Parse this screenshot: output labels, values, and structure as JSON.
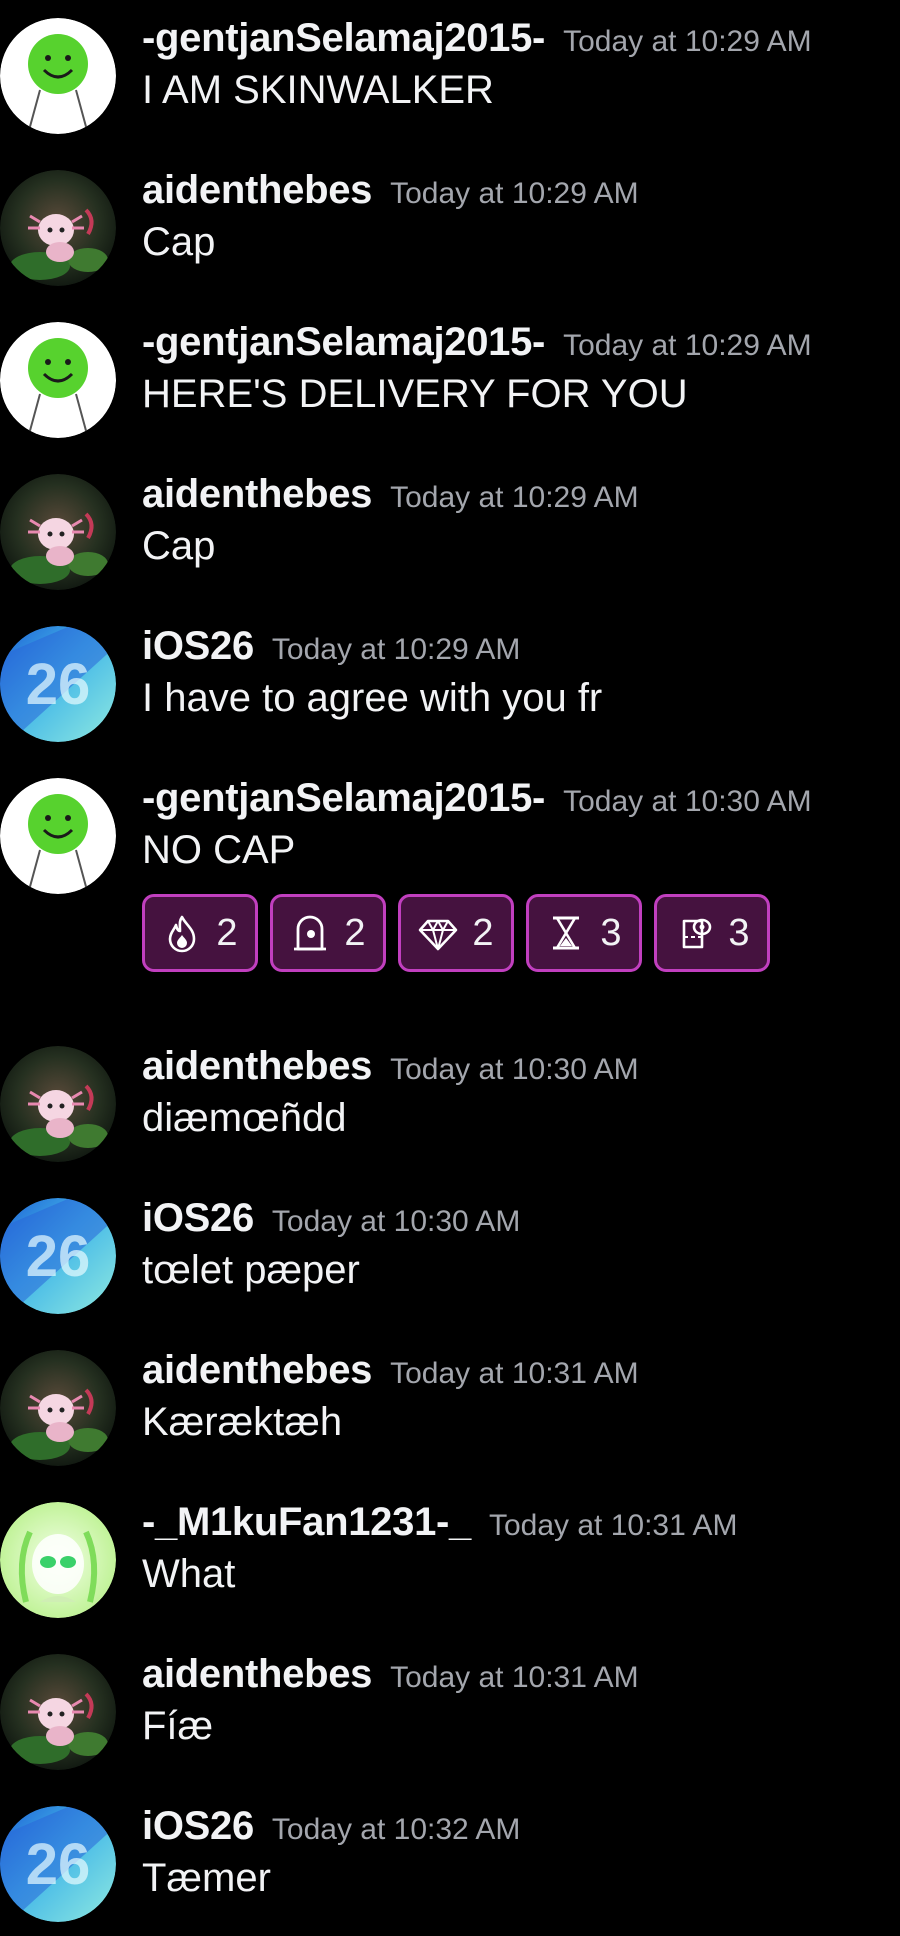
{
  "messages": [
    {
      "author": "-gentjanSelamaj2015-",
      "time": "Today at 10:29 AM",
      "text": "I AM SKINWALKER"
    },
    {
      "author": "aidenthebes",
      "time": "Today at 10:29 AM",
      "text": "Cap"
    },
    {
      "author": "-gentjanSelamaj2015-",
      "time": "Today at 10:29 AM",
      "text": "HERE'S DELIVERY FOR YOU"
    },
    {
      "author": "aidenthebes",
      "time": "Today at 10:29 AM",
      "text": "Cap"
    },
    {
      "author": "iOS26",
      "time": "Today at 10:29 AM",
      "text": "I have to agree with you fr"
    },
    {
      "author": "-gentjanSelamaj2015-",
      "time": "Today at 10:30 AM",
      "text": "NO CAP"
    },
    {
      "author": "aidenthebes",
      "time": "Today at 10:30 AM",
      "text": "diæmœñdd"
    },
    {
      "author": "iOS26",
      "time": "Today at 10:30 AM",
      "text": "tœlet pæper"
    },
    {
      "author": "aidenthebes",
      "time": "Today at 10:31 AM",
      "text": "Kæræktæh"
    },
    {
      "author": "-_M1kuFan1231-_",
      "time": "Today at 10:31 AM",
      "text": "What"
    },
    {
      "author": "aidenthebes",
      "time": "Today at 10:31 AM",
      "text": "Fíæ"
    },
    {
      "author": "iOS26",
      "time": "Today at 10:32 AM",
      "text": "Tæmer"
    }
  ],
  "reactions": [
    {
      "icon": "fire-icon",
      "count": "2"
    },
    {
      "icon": "tombstone-icon",
      "count": "2"
    },
    {
      "icon": "diamond-icon",
      "count": "2"
    },
    {
      "icon": "hourglass-icon",
      "count": "3"
    },
    {
      "icon": "toilet-paper-icon",
      "count": "3"
    }
  ],
  "colors": {
    "background": "#000000",
    "username": "#f2f3f5",
    "timestamp": "#a3a6ad",
    "reaction_border": "#c13fbf",
    "reaction_fill": "#45123f"
  }
}
